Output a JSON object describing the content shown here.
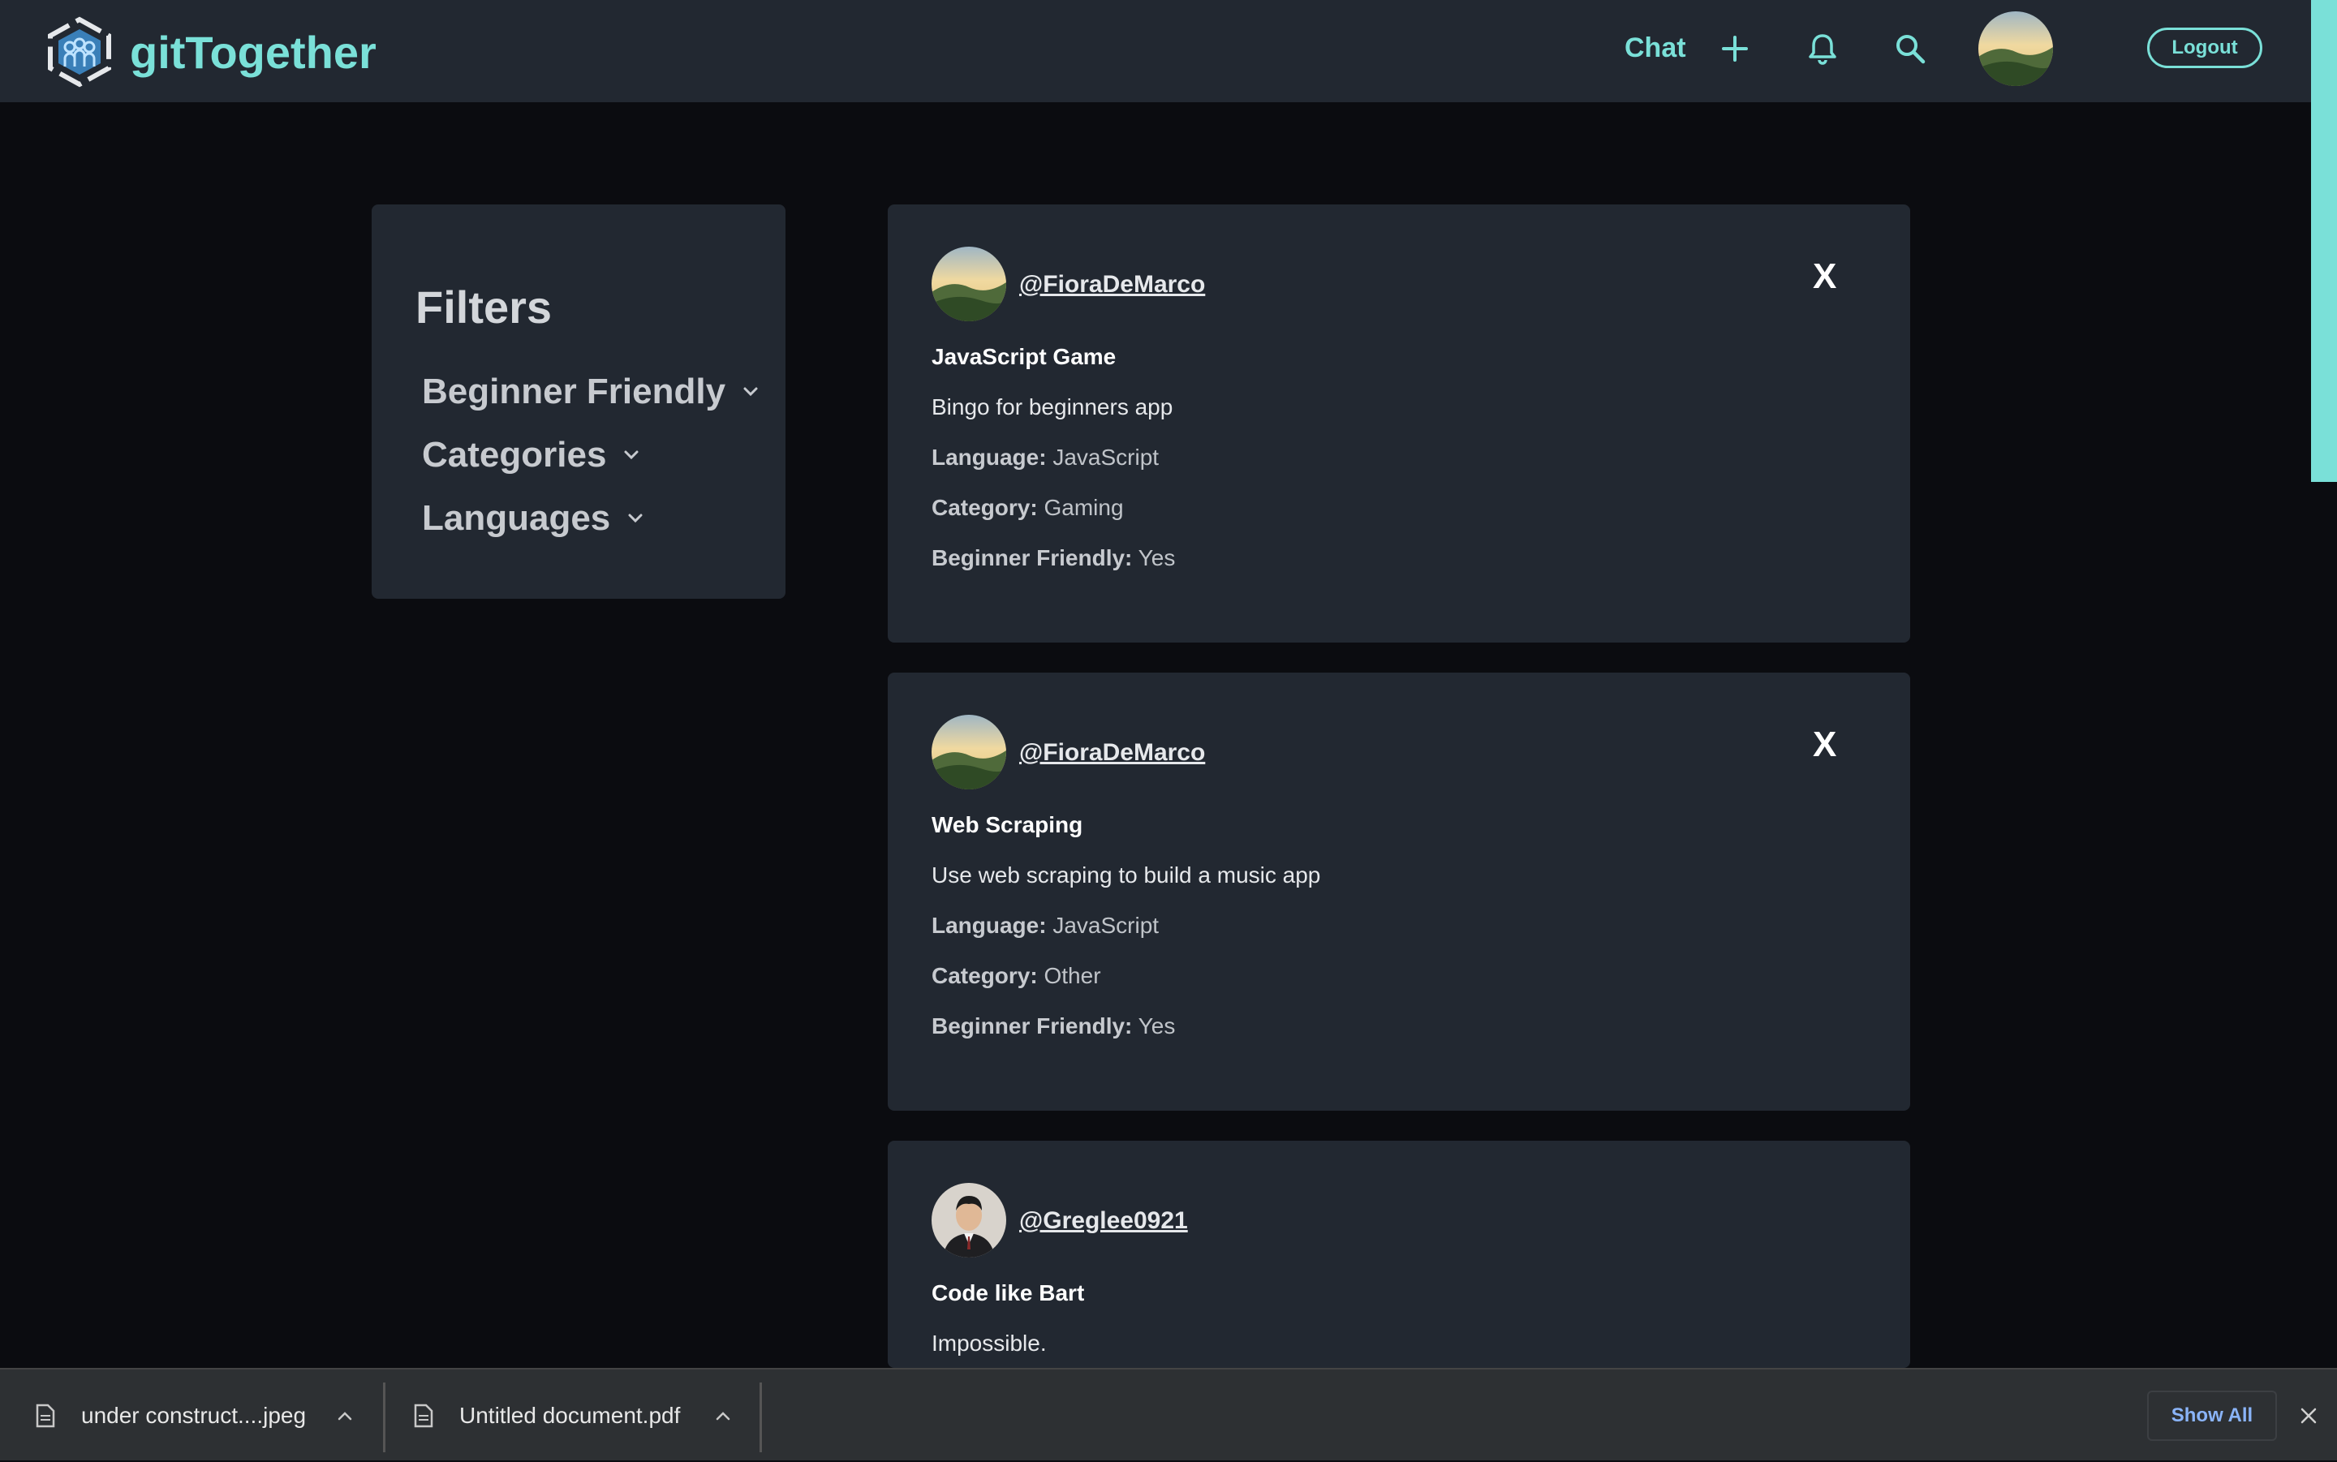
{
  "navbar": {
    "brand_name": "gitTogether",
    "chat_label": "Chat",
    "logout_label": "Logout"
  },
  "filters": {
    "title": "Filters",
    "items": [
      {
        "label": "Beginner Friendly"
      },
      {
        "label": "Categories"
      },
      {
        "label": "Languages"
      }
    ]
  },
  "labels": {
    "language": "Language:",
    "category": "Category:",
    "beginner": "Beginner Friendly:"
  },
  "posts": [
    {
      "username": "@FioraDeMarco",
      "close_label": "X",
      "title": "JavaScript Game",
      "description": "Bingo for beginners app",
      "language": "JavaScript",
      "category": "Gaming",
      "beginner_friendly": "Yes"
    },
    {
      "username": "@FioraDeMarco",
      "close_label": "X",
      "title": "Web Scraping",
      "description": "Use web scraping to build a music app",
      "language": "JavaScript",
      "category": "Other",
      "beginner_friendly": "Yes"
    },
    {
      "username": "@Greglee0921",
      "title": "Code like Bart",
      "description": "Impossible."
    }
  ],
  "downloads": {
    "items": [
      {
        "name": "under construct....jpeg"
      },
      {
        "name": "Untitled document.pdf"
      }
    ],
    "show_all_label": "Show All"
  },
  "colors": {
    "accent": "#7ae0d8",
    "background": "#0b0c10",
    "panel": "#222831"
  }
}
